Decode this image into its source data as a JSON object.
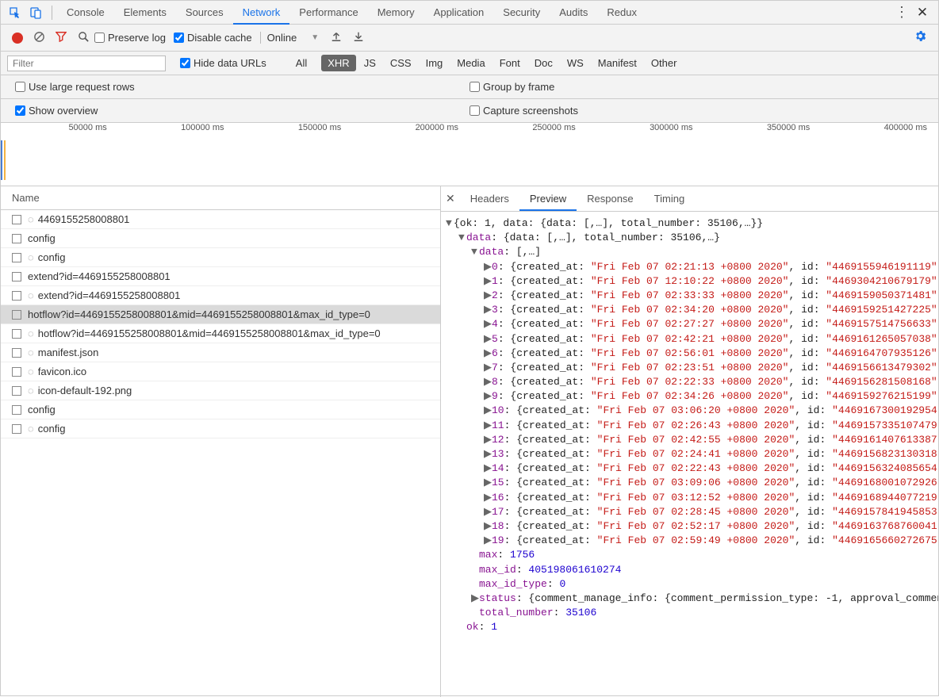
{
  "main_tabs": [
    "Console",
    "Elements",
    "Sources",
    "Network",
    "Performance",
    "Memory",
    "Application",
    "Security",
    "Audits",
    "Redux"
  ],
  "main_tab_active": "Network",
  "toolbar": {
    "preserve_log": "Preserve log",
    "disable_cache": "Disable cache",
    "throttle": "Online"
  },
  "filter": {
    "placeholder": "Filter",
    "hide_data_urls": "Hide data URLs",
    "types": [
      "All",
      "XHR",
      "JS",
      "CSS",
      "Img",
      "Media",
      "Font",
      "Doc",
      "WS",
      "Manifest",
      "Other"
    ],
    "type_active": "XHR"
  },
  "checks": {
    "large_rows": "Use large request rows",
    "group_frame": "Group by frame",
    "show_overview": "Show overview",
    "capture": "Capture screenshots"
  },
  "timeline_ticks": [
    "50000 ms",
    "100000 ms",
    "150000 ms",
    "200000 ms",
    "250000 ms",
    "300000 ms",
    "350000 ms",
    "400000 ms"
  ],
  "name_header": "Name",
  "requests": [
    {
      "wheel": true,
      "text": "4469155258008801"
    },
    {
      "wheel": false,
      "text": "config"
    },
    {
      "wheel": true,
      "text": "config"
    },
    {
      "wheel": false,
      "text": "extend?id=4469155258008801"
    },
    {
      "wheel": true,
      "text": "extend?id=4469155258008801"
    },
    {
      "wheel": false,
      "text": "hotflow?id=4469155258008801&mid=4469155258008801&max_id_type=0",
      "selected": true
    },
    {
      "wheel": true,
      "text": "hotflow?id=4469155258008801&mid=4469155258008801&max_id_type=0"
    },
    {
      "wheel": true,
      "text": "manifest.json"
    },
    {
      "wheel": true,
      "text": "favicon.ico"
    },
    {
      "wheel": true,
      "text": "icon-default-192.png"
    },
    {
      "wheel": false,
      "text": "config"
    },
    {
      "wheel": true,
      "text": "config"
    }
  ],
  "detail_tabs": [
    "Headers",
    "Preview",
    "Response",
    "Timing"
  ],
  "detail_tab_active": "Preview",
  "preview": {
    "root_summary": "{ok: 1, data: {data: [,…], total_number: 35106,…}}",
    "data_summary": "{data: [,…], total_number: 35106,…}",
    "inner_data_summary": "[,…]",
    "items": [
      {
        "i": "0",
        "t": "Fri Feb 07 02:21:13 +0800 2020",
        "id": "4469155946191119"
      },
      {
        "i": "1",
        "t": "Fri Feb 07 12:10:22 +0800 2020",
        "id": "4469304210679179"
      },
      {
        "i": "2",
        "t": "Fri Feb 07 02:33:33 +0800 2020",
        "id": "4469159050371481"
      },
      {
        "i": "3",
        "t": "Fri Feb 07 02:34:20 +0800 2020",
        "id": "4469159251427225"
      },
      {
        "i": "4",
        "t": "Fri Feb 07 02:27:27 +0800 2020",
        "id": "4469157514756633"
      },
      {
        "i": "5",
        "t": "Fri Feb 07 02:42:21 +0800 2020",
        "id": "4469161265057038"
      },
      {
        "i": "6",
        "t": "Fri Feb 07 02:56:01 +0800 2020",
        "id": "4469164707935126"
      },
      {
        "i": "7",
        "t": "Fri Feb 07 02:23:51 +0800 2020",
        "id": "4469156613479302"
      },
      {
        "i": "8",
        "t": "Fri Feb 07 02:22:33 +0800 2020",
        "id": "4469156281508168"
      },
      {
        "i": "9",
        "t": "Fri Feb 07 02:34:26 +0800 2020",
        "id": "4469159276215199"
      },
      {
        "i": "10",
        "t": "Fri Feb 07 03:06:20 +0800 2020",
        "id": "4469167300192954"
      },
      {
        "i": "11",
        "t": "Fri Feb 07 02:26:43 +0800 2020",
        "id": "4469157335107479"
      },
      {
        "i": "12",
        "t": "Fri Feb 07 02:42:55 +0800 2020",
        "id": "4469161407613387"
      },
      {
        "i": "13",
        "t": "Fri Feb 07 02:24:41 +0800 2020",
        "id": "4469156823130318"
      },
      {
        "i": "14",
        "t": "Fri Feb 07 02:22:43 +0800 2020",
        "id": "4469156324085654"
      },
      {
        "i": "15",
        "t": "Fri Feb 07 03:09:06 +0800 2020",
        "id": "4469168001072926"
      },
      {
        "i": "16",
        "t": "Fri Feb 07 03:12:52 +0800 2020",
        "id": "4469168944077219"
      },
      {
        "i": "17",
        "t": "Fri Feb 07 02:28:45 +0800 2020",
        "id": "4469157841945853"
      },
      {
        "i": "18",
        "t": "Fri Feb 07 02:52:17 +0800 2020",
        "id": "4469163768760041"
      },
      {
        "i": "19",
        "t": "Fri Feb 07 02:59:49 +0800 2020",
        "id": "4469165660272675"
      }
    ],
    "max_label": "max",
    "max": "1756",
    "maxid_label": "max_id",
    "max_id": "405198061610274",
    "maxidtype_label": "max_id_type",
    "max_id_type": "0",
    "status_label": "status",
    "status_summary": "{comment_manage_info: {comment_permission_type: -1, approval_commen",
    "total_label": "total_number",
    "total_number": "35106",
    "ok_label": "ok",
    "ok": "1",
    "data_label": "data"
  }
}
